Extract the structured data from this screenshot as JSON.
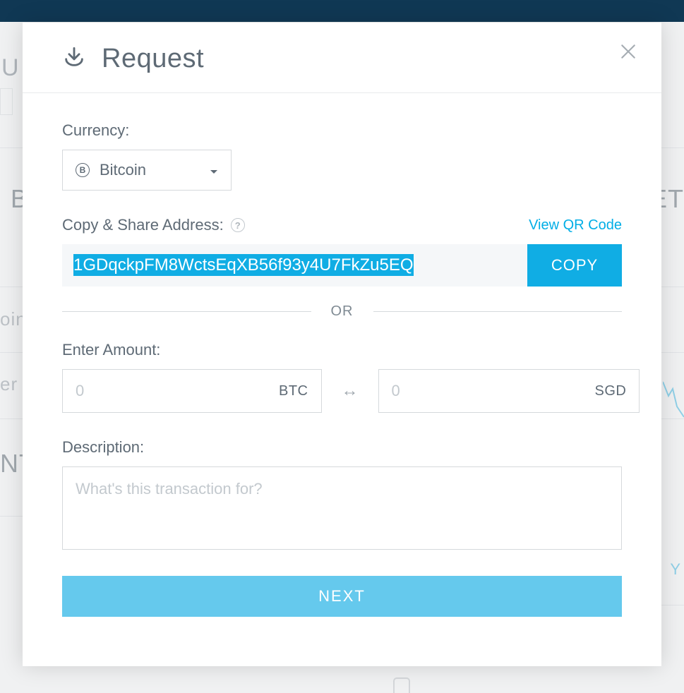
{
  "modal": {
    "title": "Request",
    "currency_label": "Currency:",
    "currency_selected": "Bitcoin",
    "address_label": "Copy & Share Address:",
    "view_qr_label": "View QR Code",
    "address_value": "1GDqckpFM8WctsEqXB56f93y4U7FkZu5EQ",
    "copy_label": "COPY",
    "or_label": "OR",
    "amount_label": "Enter Amount:",
    "amount_btc_placeholder": "0",
    "amount_btc_unit": "BTC",
    "amount_fiat_placeholder": "0",
    "amount_fiat_unit": "SGD",
    "description_label": "Description:",
    "description_placeholder": "What's this transaction for?",
    "next_label": "NEXT"
  },
  "background": {
    "letter_top_left": "U",
    "letter_right_1": "ET",
    "row1": "oin",
    "row2": "er W",
    "row3": "NT",
    "letter_b": "B",
    "letter_y": "Y"
  }
}
